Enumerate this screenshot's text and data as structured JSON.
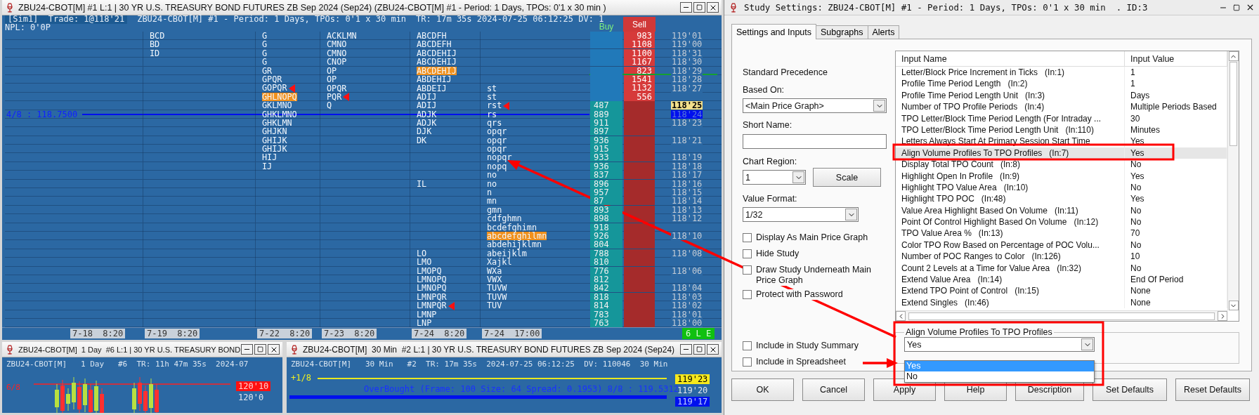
{
  "chart_window": {
    "title": "ZBU24-CBOT[M] #1 L:1 | 30 YR U.S. TREASURY BOND FUTURES ZB Sep 2024 (Sep24) (ZBU24-CBOT[M] #1 - Period: 1 Days, TPOs: 0'1 x 30 min )",
    "header": {
      "account": "[Sim1]",
      "trade": "Trade: 1@118'21",
      "study": "ZBU24-CBOT[M] #1 - Period: 1 Days, TPOs: 0'1 x 30 min",
      "stats": "TR: 17m 35s 2024-07-25 06:12:25 DV: 1",
      "npl": "NPL: 0'0P",
      "buy": "Buy",
      "sell": "Sell"
    },
    "rows": [
      {
        "price": "119'01",
        "sell": "983",
        "tpo": {
          "profile_1": {
            "letters": "BCD",
            "open": false,
            "marker": false
          },
          "profile_2": {
            "letters": "G",
            "open": false,
            "marker": false
          },
          "profile_3": {
            "letters": "ACKLMN",
            "open": false,
            "marker": false
          },
          "profile_4": {
            "letters": "ABCDFH",
            "open": false,
            "marker": false
          }
        }
      },
      {
        "price": "119'00",
        "sell": "1108",
        "tpo": {
          "profile_1": {
            "letters": "BD",
            "open": false,
            "marker": false
          },
          "profile_2": {
            "letters": "G",
            "open": false,
            "marker": false
          },
          "profile_3": {
            "letters": "CMNO",
            "open": false,
            "marker": false
          },
          "profile_4": {
            "letters": "ABCDEFH",
            "open": false,
            "marker": false
          }
        }
      },
      {
        "price": "118'31",
        "sell": "1100",
        "tpo": {
          "profile_1": {
            "letters": "ID",
            "open": false,
            "marker": false
          },
          "profile_2": {
            "letters": "G",
            "open": false,
            "marker": false
          },
          "profile_3": {
            "letters": "CMNO",
            "open": false,
            "marker": false
          },
          "profile_4": {
            "letters": "ABCDEHIJ",
            "open": false,
            "marker": false
          }
        }
      },
      {
        "price": "118'30",
        "sell": "1167",
        "tpo": {
          "profile_2": {
            "letters": "G",
            "open": false,
            "marker": false
          },
          "profile_3": {
            "letters": "CNOP",
            "open": false,
            "marker": false
          },
          "profile_4": {
            "letters": "ABCDEHIJ",
            "open": false,
            "marker": false
          }
        }
      },
      {
        "price": "118'29",
        "sell": "823",
        "session_line": true,
        "tpo": {
          "profile_2": {
            "letters": "GR",
            "open": false,
            "marker": false
          },
          "profile_3": {
            "letters": "OP",
            "open": false,
            "marker": false
          },
          "profile_4": {
            "letters": "ABCDEHIJ",
            "open": true,
            "marker": false
          }
        }
      },
      {
        "price": "118'28",
        "sell": "1541",
        "tpo": {
          "profile_2": {
            "letters": "GPQR",
            "open": false,
            "marker": false
          },
          "profile_3": {
            "letters": "OP",
            "open": false,
            "marker": false
          },
          "profile_4": {
            "letters": "ABDEHIJ",
            "open": false,
            "marker": false
          }
        }
      },
      {
        "price": "118'27",
        "sell": "1132",
        "tpo": {
          "profile_2": {
            "letters": "GOPQR",
            "open": false,
            "marker": true
          },
          "profile_3": {
            "letters": "OPQR",
            "open": false,
            "marker": false
          },
          "profile_4": {
            "letters": "ABDEIJ",
            "open": false,
            "marker": false
          },
          "profile_5": {
            "letters": "st",
            "open": false,
            "marker": false
          }
        }
      },
      {
        "sell": "556",
        "tpo": {
          "profile_2": {
            "letters": "GHLNOPQ",
            "open": true,
            "marker": false
          },
          "profile_3": {
            "letters": "PQR",
            "open": false,
            "marker": true
          },
          "profile_4": {
            "letters": "ADIJ",
            "open": false,
            "marker": false
          },
          "profile_5": {
            "letters": "st",
            "open": false,
            "marker": false
          }
        }
      },
      {
        "price": "118'25",
        "kind": "last",
        "buy": "487",
        "tpo": {
          "profile_2": {
            "letters": "GKLMNO",
            "open": false,
            "marker": false
          },
          "profile_3": {
            "letters": "Q",
            "open": false,
            "marker": false
          },
          "profile_4": {
            "letters": "ADIJ",
            "open": false,
            "marker": false
          },
          "profile_5": {
            "letters": "rst",
            "open": false,
            "marker": true
          }
        }
      },
      {
        "price": "118'24",
        "kind": "bid",
        "buy": "889",
        "level_line": "4/8 : 118.7500",
        "tpo": {
          "profile_2": {
            "letters": "GHKLMNO",
            "open": false,
            "marker": false
          },
          "profile_4": {
            "letters": "ADJK",
            "open": false,
            "marker": false
          },
          "profile_5": {
            "letters": "rs",
            "open": false,
            "marker": false
          }
        }
      },
      {
        "price": "118'23",
        "buy": "911",
        "tpo": {
          "profile_2": {
            "letters": "GHKLMN",
            "open": false,
            "marker": false
          },
          "profile_4": {
            "letters": "ADJK",
            "open": false,
            "marker": false
          },
          "profile_5": {
            "letters": "qrs",
            "open": false,
            "marker": false
          }
        }
      },
      {
        "buy": "897",
        "tpo": {
          "profile_2": {
            "letters": "GHJKN",
            "open": false,
            "marker": false
          },
          "profile_4": {
            "letters": "DJK",
            "open": false,
            "marker": false
          },
          "profile_5": {
            "letters": "opqr",
            "open": false,
            "marker": false
          }
        }
      },
      {
        "price": "118'21",
        "buy": "936",
        "tpo": {
          "profile_2": {
            "letters": "GHIJK",
            "open": false,
            "marker": false
          },
          "profile_4": {
            "letters": "DK",
            "open": false,
            "marker": false
          },
          "profile_5": {
            "letters": "opqr",
            "open": false,
            "marker": false
          }
        }
      },
      {
        "buy": "915",
        "tpo": {
          "profile_2": {
            "letters": "GHIJK",
            "open": false,
            "marker": false
          },
          "profile_5": {
            "letters": "opqr",
            "open": false,
            "marker": false
          }
        }
      },
      {
        "price": "118'19",
        "buy": "933",
        "tpo": {
          "profile_2": {
            "letters": "HIJ",
            "open": false,
            "marker": false
          },
          "profile_5": {
            "letters": "nopqr",
            "open": false,
            "marker": false
          }
        }
      },
      {
        "price": "118'18",
        "buy": "936",
        "tpo": {
          "profile_2": {
            "letters": "IJ",
            "open": false,
            "marker": false
          },
          "profile_5": {
            "letters": "nopq",
            "open": false,
            "marker": false
          }
        }
      },
      {
        "price": "118'17",
        "buy": "837",
        "tpo": {
          "profile_5": {
            "letters": "no",
            "open": false,
            "marker": false
          }
        }
      },
      {
        "price": "118'16",
        "buy": "896",
        "tpo": {
          "profile_4": {
            "letters": "IL",
            "open": false,
            "marker": false
          },
          "profile_5": {
            "letters": "no",
            "open": false,
            "marker": false
          }
        }
      },
      {
        "price": "118'15",
        "buy": "957",
        "tpo": {
          "profile_5": {
            "letters": "n",
            "open": false,
            "marker": false
          }
        }
      },
      {
        "price": "118'14",
        "buy": "87",
        "tpo": {
          "profile_5": {
            "letters": "mn",
            "open": false,
            "marker": false
          }
        }
      },
      {
        "price": "118'13",
        "buy": "893",
        "tpo": {
          "profile_5": {
            "letters": "gmn",
            "open": false,
            "marker": false
          }
        }
      },
      {
        "price": "118'12",
        "buy": "898",
        "tpo": {
          "profile_5": {
            "letters": "cdfghmn",
            "open": false,
            "marker": false
          }
        }
      },
      {
        "buy": "918",
        "tpo": {
          "profile_5": {
            "letters": "bcdefghimn",
            "open": false,
            "marker": false
          }
        }
      },
      {
        "price": "118'10",
        "buy": "926",
        "tpo": {
          "profile_5": {
            "letters": "abcdefghilmn",
            "open": true,
            "marker": false
          }
        }
      },
      {
        "buy": "804",
        "tpo": {
          "profile_5": {
            "letters": "abdehijklmn",
            "open": false,
            "marker": false
          }
        }
      },
      {
        "price": "118'08",
        "buy": "788",
        "tpo": {
          "profile_4": {
            "letters": "LO",
            "open": false,
            "marker": false
          },
          "profile_5": {
            "letters": "abeijklm",
            "open": false,
            "marker": false
          }
        }
      },
      {
        "buy": "810",
        "tpo": {
          "profile_4": {
            "letters": "LMO",
            "open": false,
            "marker": false
          },
          "profile_5": {
            "letters": "Xajkl",
            "open": false,
            "marker": false
          }
        }
      },
      {
        "price": "118'06",
        "buy": "776",
        "tpo": {
          "profile_4": {
            "letters": "LMOPQ",
            "open": false,
            "marker": false
          },
          "profile_5": {
            "letters": "WXa",
            "open": false,
            "marker": false
          }
        }
      },
      {
        "buy": "812",
        "tpo": {
          "profile_4": {
            "letters": "LMNOPQ",
            "open": false,
            "marker": false
          },
          "profile_5": {
            "letters": "VWX",
            "open": false,
            "marker": false
          }
        }
      },
      {
        "price": "118'04",
        "buy": "842",
        "tpo": {
          "profile_4": {
            "letters": "LMNOPQ",
            "open": false,
            "marker": false
          },
          "profile_5": {
            "letters": "TUVW",
            "open": false,
            "marker": false
          }
        }
      },
      {
        "price": "118'03",
        "buy": "818",
        "tpo": {
          "profile_4": {
            "letters": "LMNPQR",
            "open": false,
            "marker": false
          },
          "profile_5": {
            "letters": "TUVW",
            "open": false,
            "marker": false
          }
        }
      },
      {
        "price": "118'02",
        "buy": "814",
        "tpo": {
          "profile_4": {
            "letters": "LMNPQR",
            "open": false,
            "marker": true
          },
          "profile_5": {
            "letters": "TUV",
            "open": false,
            "marker": false
          }
        }
      },
      {
        "price": "118'01",
        "buy": "783",
        "tpo": {
          "profile_4": {
            "letters": "LMNP",
            "open": false,
            "marker": false
          }
        }
      },
      {
        "price": "118'00",
        "buy": "763",
        "tpo": {
          "profile_4": {
            "letters": "LNP",
            "open": false,
            "marker": false
          }
        }
      }
    ],
    "dates": [
      "7-18  8:20",
      "7-19  8:20",
      "7-22  8:20",
      "7-23  8:20",
      "7-24  8:20",
      "7-24  17:00"
    ],
    "status_badge": "6 L E"
  },
  "daily_window": {
    "title": "ZBU24-CBOT[M]  1 Day  #6 L:1 | 30 YR U.S. TREASURY BOND",
    "header": "ZBU24-CBOT[M]   1 Day   #6  TR: 11h 47m 35s  2024-07",
    "level_label": "6/8",
    "price_tag": "120'10",
    "price_axis": "120'0"
  },
  "intraday_window": {
    "title": "ZBU24-CBOT[M]  30 Min  #2 L:1 | 30 YR U.S. TREASURY BOND FUTURES ZB Sep 2024 (Sep24)",
    "header": "ZBU24-CBOT[M]   30 Min   #2  TR: 17m 35s  2024-07-25 06:12:25  DV: 110046  30 Min",
    "level_label": "+1/8",
    "study_label": "OverBought (Frame: 100 Size: 64 Spread: 0.1953) 8/8 : 119.5312",
    "prices": [
      {
        "label": "119'23",
        "kind": "last"
      },
      {
        "label": "119'20",
        "kind": "plain"
      },
      {
        "label": "119'17",
        "kind": "bid"
      }
    ]
  },
  "dialog": {
    "title": "Study Settings: ZBU24-CBOT[M] #1 - Period: 1 Days, TPOs: 0'1 x 30 min  . ID:3",
    "tabs": [
      {
        "label": "Settings and Inputs",
        "selected": true
      },
      {
        "label": "Subgraphs",
        "selected": false
      },
      {
        "label": "Alerts",
        "selected": false
      }
    ],
    "precedence": "Standard Precedence",
    "based_on": {
      "label": "Based On:",
      "value": "<Main Price Graph>"
    },
    "short_name": {
      "label": "Short Name:"
    },
    "chart_region": {
      "label": "Chart Region:",
      "value": "1"
    },
    "scale_button": "Scale",
    "value_format": {
      "label": "Value Format:",
      "value": "1/32"
    },
    "options": [
      {
        "label": "Display As Main Price Graph",
        "checked": false
      },
      {
        "label": "Hide Study",
        "checked": false
      },
      {
        "label": "Draw Study Underneath Main Price Graph",
        "checked": false
      },
      {
        "label": "Protect with Password",
        "checked": false
      }
    ],
    "summary_options": [
      {
        "label": "Include in Study Summary",
        "checked": false
      },
      {
        "label": "Include in Spreadsheet",
        "checked": false
      }
    ],
    "table": {
      "columns": [
        "Input Name",
        "Input Value"
      ],
      "rows": [
        {
          "name": "Letter/Block Price Increment in Ticks   (In:1)",
          "value": "1",
          "selected": false
        },
        {
          "name": "Profile Time Period Length   (In:2)",
          "value": "1",
          "selected": false
        },
        {
          "name": "Profile Time Period Length Unit   (In:3)",
          "value": "Days",
          "selected": false
        },
        {
          "name": "Number of TPO Profile Periods   (In:4)",
          "value": "Multiple Periods Based",
          "selected": false
        },
        {
          "name": "TPO Letter/Block Time Period Length (For Intraday ...",
          "value": "30",
          "selected": false
        },
        {
          "name": "TPO Letter/Block Time Period Length Unit   (In:110)",
          "value": "Minutes",
          "selected": false
        },
        {
          "name": "Letters Always Start At Primary Session Start Time",
          "value": "Yes",
          "selected": false
        },
        {
          "name": "Align Volume Profiles To TPO Profiles   (In:7)",
          "value": "Yes",
          "selected": true
        },
        {
          "name": "Display Total TPO Count   (In:8)",
          "value": "No",
          "selected": false
        },
        {
          "name": "Highlight Open In Profile   (In:9)",
          "value": "Yes",
          "selected": false
        },
        {
          "name": "Highlight TPO Value Area   (In:10)",
          "value": "No",
          "selected": false
        },
        {
          "name": "Highlight TPO POC   (In:48)",
          "value": "Yes",
          "selected": false
        },
        {
          "name": "Value Area Highlight Based On Volume   (In:11)",
          "value": "No",
          "selected": false
        },
        {
          "name": "Point Of Control Highlight Based On Volume   (In:12)",
          "value": "No",
          "selected": false
        },
        {
          "name": "TPO Value Area %   (In:13)",
          "value": "70",
          "selected": false
        },
        {
          "name": "Color TPO Row Based on Percentage of POC Volu...",
          "value": "No",
          "selected": false
        },
        {
          "name": "Number of POC Ranges to Color   (In:126)",
          "value": "10",
          "selected": false
        },
        {
          "name": "Count 2 Levels at a Time for Value Area   (In:32)",
          "value": "No",
          "selected": false
        },
        {
          "name": "Extend Value Area   (In:14)",
          "value": "End Of Period",
          "selected": false
        },
        {
          "name": "Extend TPO Point of Control   (In:15)",
          "value": "None",
          "selected": false
        },
        {
          "name": "Extend Singles   (In:46)",
          "value": "None",
          "selected": false
        }
      ]
    },
    "editor": {
      "legend": "Align Volume Profiles To TPO Profiles",
      "value": "Yes",
      "options": [
        {
          "label": "Yes",
          "selected": true
        },
        {
          "label": "No",
          "selected": false
        }
      ]
    },
    "buttons": [
      "OK",
      "Cancel",
      "Apply",
      "Help",
      "Description",
      "Set Defaults",
      "Reset Defaults"
    ]
  }
}
